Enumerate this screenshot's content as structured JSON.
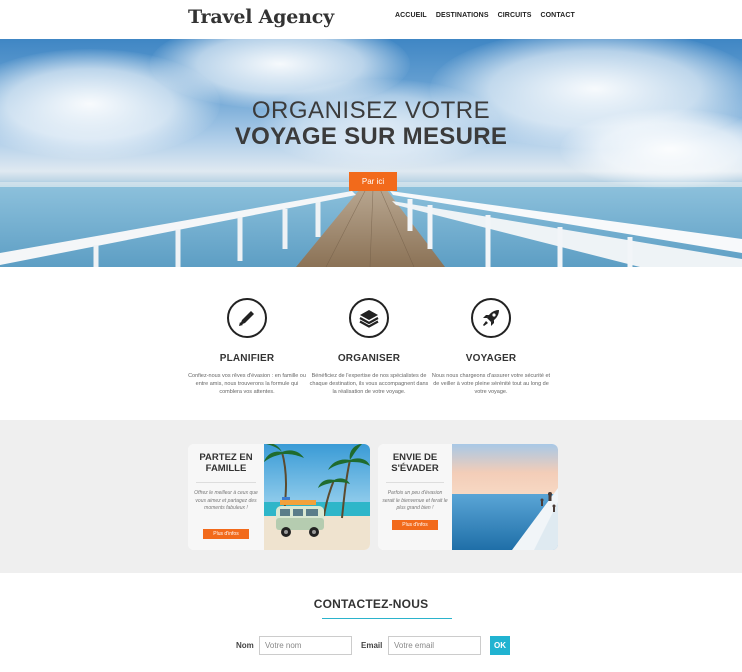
{
  "header": {
    "logo": "Travel Agency",
    "nav": [
      "ACCUEIL",
      "DESTINATIONS",
      "CIRCUITS",
      "CONTACT"
    ]
  },
  "hero": {
    "title_line1": "ORGANISEZ VOTRE",
    "title_line2": "VOYAGE SUR MESURE",
    "button": "Par ici"
  },
  "features": [
    {
      "icon": "pencil-icon",
      "title": "PLANIFIER",
      "text": "Confiez-nous vos rêves d'évasion : en famille ou entre amis, nous trouverons la formule qui comblera vos attentes."
    },
    {
      "icon": "layers-icon",
      "title": "ORGANISER",
      "text": "Bénéficiez de l'expertise de nos spécialistes de chaque destination, ils vous accompagnent dans la réalisation de votre voyage."
    },
    {
      "icon": "rocket-icon",
      "title": "VOYAGER",
      "text": "Nous nous chargeons d'assurer votre sécurité et de veiller à votre pleine sérénité tout au long de votre voyage."
    }
  ],
  "cards": [
    {
      "title": "PARTEZ EN FAMILLE",
      "text": "Offrez le meilleur à ceux que vous aimez et partagez des moments fabuleux !",
      "button": "Plus d'infos"
    },
    {
      "title": "ENVIE DE S'ÉVADER",
      "text": "Parfois un peu d'évasion serait le bienvenue et ferait le plus grand bien !",
      "button": "Plus d'infos"
    }
  ],
  "contact": {
    "title": "CONTACTEZ-NOUS",
    "name_label": "Nom",
    "name_placeholder": "Votre nom",
    "email_label": "Email",
    "email_placeholder": "Votre email",
    "submit": "OK"
  },
  "colors": {
    "accent_orange": "#f26a1b",
    "accent_cyan": "#21b3d1"
  }
}
